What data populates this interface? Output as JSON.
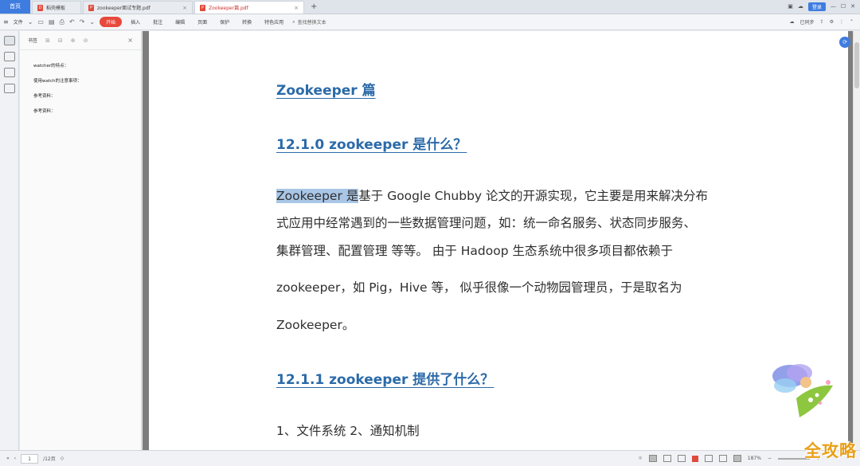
{
  "tabs": {
    "home": "首页",
    "items": [
      {
        "label": "稻壳模板",
        "active": false
      },
      {
        "label": "zookeeper面试专题.pdf",
        "active": false
      },
      {
        "label": "Zookeeper篇.pdf",
        "active": true
      }
    ],
    "add": "+",
    "login": "登录"
  },
  "toolbar": {
    "file_menu": "文件",
    "start": "开始",
    "items": [
      "插入",
      "批注",
      "编辑",
      "页面",
      "保护",
      "转换",
      "特色应用"
    ],
    "search_placeholder": "查找替换文本",
    "sync_label": "已同步"
  },
  "bookmarks": {
    "title": "书签",
    "items": [
      "watcher的特点：",
      "使用watch的注意事项：",
      "参考资料：",
      "参考资料："
    ]
  },
  "document": {
    "heading_main": "Zookeeper 篇",
    "heading_1": "12.1.0 zookeeper 是什么？",
    "para1_highlight": "Zookeeper 是",
    "para1_line1_rest": "基于 Google Chubby 论文的开源实现，它主要是用来解决分布",
    "para1_line2": "式应用中经常遇到的一些数据管理问题，如：统一命名服务、状态同步服务、",
    "para1_line3": "集群管理、配置管理  等等。  由于 Hadoop 生态系统中很多项目都依赖于",
    "para1_line4": "zookeeper，如 Pig，Hive 等，   似乎很像一个动物园管理员，于是取名为",
    "para1_line5": "Zookeeper。",
    "heading_2": "12.1.1 zookeeper 提供了什么？",
    "list_1": "1、文件系统  2、通知机制"
  },
  "statusbar": {
    "current_page": "1",
    "total_pages": "/12页",
    "zoom": "187%"
  },
  "watermark": "全攻略",
  "colors": {
    "accent": "#3f7ce0",
    "heading": "#2b6aa8",
    "start": "#e8483c",
    "watermark": "#e9a018"
  }
}
